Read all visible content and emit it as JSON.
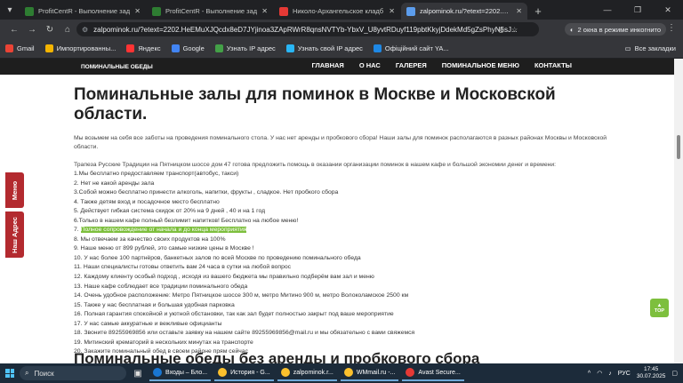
{
  "browser": {
    "tabs": [
      {
        "title": "ProfitCentR - Выполнение зад",
        "color": "#2e7d32",
        "active": false
      },
      {
        "title": "ProfitCentR - Выполнение зад",
        "color": "#2e7d32",
        "active": false
      },
      {
        "title": "Николо-Архангельское кладб",
        "color": "#e53935",
        "active": false
      },
      {
        "title": "zalpominok.ru/?etext=2202.HeM",
        "color": "#5c9ded",
        "active": true
      }
    ],
    "url": "zalpominok.ru/?etext=2202.HeEMuXJQcdx8eD7JYjinoa3ZApRWrR8qnsNVTYb-YbxV_U8yvtRDuyf119pbtKkyjDdekMd5gZsPhyN5sJ...",
    "incognito_label": "2 окна в режиме инкогнито",
    "bookmarks": [
      {
        "label": "Gmail",
        "color": "#ea4335"
      },
      {
        "label": "Импортированны...",
        "color": "#f4b400"
      },
      {
        "label": "Яндекс",
        "color": "#ff3333"
      },
      {
        "label": "Google",
        "color": "#4285f4"
      },
      {
        "label": "Узнать IP адрес",
        "color": "#43a047"
      },
      {
        "label": "Узнать свой IP адрес",
        "color": "#29b6f6"
      },
      {
        "label": "Офіційний сайт YA...",
        "color": "#1e88e5"
      }
    ],
    "all_bookmarks": "Все закладки"
  },
  "site": {
    "logo": "ПОМИНАЛЬНЫЕ ОБЕДЫ",
    "menu": [
      "ГЛАВНАЯ",
      "О НАС",
      "ГАЛЕРЕЯ",
      "ПОМИНАЛЬНОЕ МЕНЮ",
      "КОНТАКТЫ"
    ],
    "heading": "Поминальные залы для поминок в Москве и Московской области.",
    "intro": "Мы возьмем на себя все заботы на проведения поминального стола. У нас нет аренды и пробкового сбора! Наши залы для поминок располагаются в разных районах Москвы и Московской области.",
    "lead": "Трапеза Русские Традиции на Пятницком шоссе дом 47 готова предложить помощь в оказании организации поминок в нашем кафе и большой экономии денег и времени:",
    "list_before": [
      "1.Мы бесплатно предоставляем транспорт(автобус, такси)",
      "2. Нет не какой аренды зала",
      "3.Собой можно бесплатно принести алкоголь, напитки, фрукты , сладкое. Нет пробкого сбора",
      "4. Также детям вход и посадочное место бесплатно",
      "5. Действует гибкая система скидок от 20% на 9 дней , 40 и на 1 год",
      "6.Только в нашем кафе полный безлимит напитков! Бесплатно на любое меню!"
    ],
    "list_hl_num": "7.",
    "list_hl_text": "Полное сопровождение от начала и до конца мероприятия",
    "list_after": [
      "8. Мы отвечаем за качество своих продуктов на 100%",
      "9. Наше меню от 899 рублей, это самые низкие цены в Москве !",
      "10. У нас более 100 партнёров, банкетных залов по всей Москве по проведению поминального обеда",
      "11. Наши специалисты готовы ответить вам 24 часа в сутки на любой вопрос",
      "12. Каждому клиенту особый подход , исходя из вашего бюджета мы правильно подберём вам зал и меню",
      "13. Наше кафе соблюдает все традиции поминального обеда",
      "14. Очень удобное расположение: Метро Пятницкое шоссе 300 м, метро Митино 900 м, метро Волоколамское 2500 км",
      "15. Также у нас бесплатная и большая удобная парковка",
      "16. Полная гарантия спокойной и уютной обстановки, так как зал будет полностью закрыт под ваше мероприятие",
      "17. У нас самые аккуратные и вежливые официанты",
      "18. Звоните 89255969856 или оставьте заявку на нашем сайте 89255969856@mail.ru и мы обязательно с вами свяжемся",
      "19. Митинский крематорий в нескольких минутах на транспорте",
      "20. Закажите поминальный обед в своем районе прям сейчас"
    ],
    "heading2": "Поминальные обеды без аренды и пробкового сбора",
    "side_menu": "Меню",
    "side_address": "Наш Адрес",
    "top_label": "TOP"
  },
  "taskbar": {
    "search": "Поиск",
    "tasks": [
      {
        "label": "Входы – Бло...",
        "color": "#1976d2"
      },
      {
        "label": "История - G...",
        "color": "#fbc02d"
      },
      {
        "label": "zalpominok.r...",
        "color": "#fbc02d"
      },
      {
        "label": "WMmail.ru -...",
        "color": "#fbc02d"
      },
      {
        "label": "Avast Secure...",
        "color": "#e53935"
      }
    ],
    "lang": "РУС",
    "time": "17:45",
    "date": "30.07.2025"
  }
}
